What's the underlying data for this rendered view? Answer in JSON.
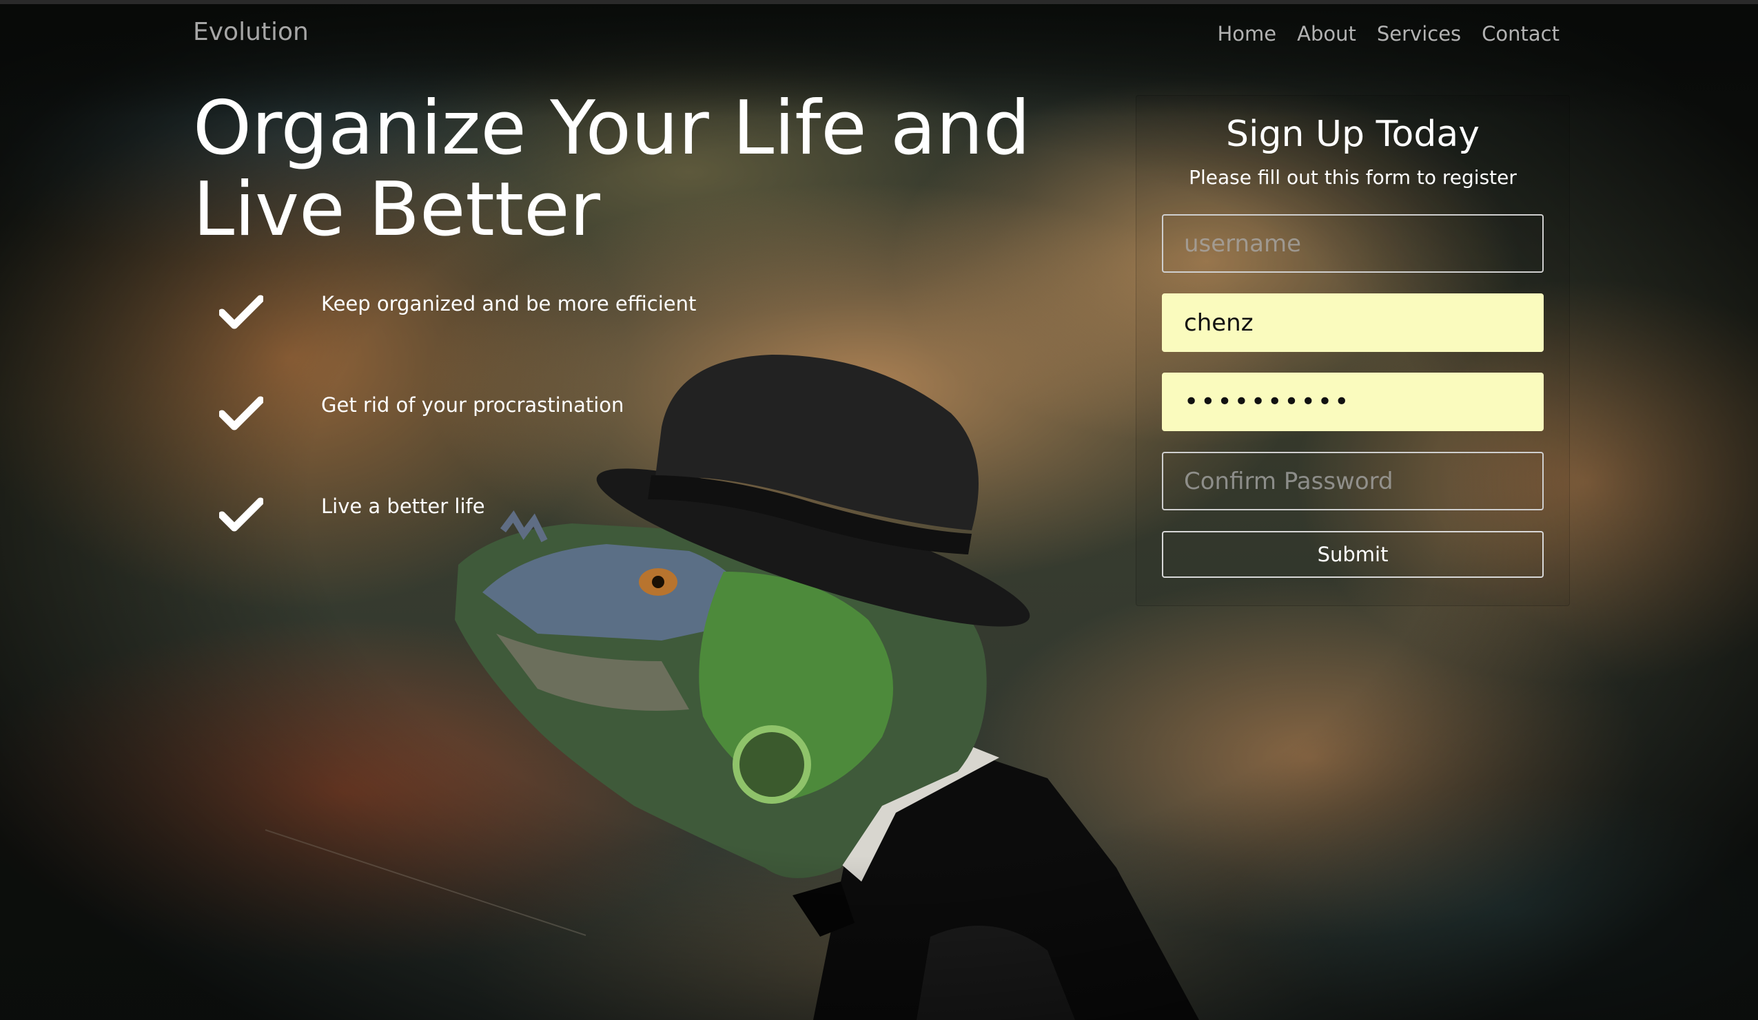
{
  "navbar": {
    "brand": "Evolution",
    "links": [
      "Home",
      "About",
      "Services",
      "Contact"
    ]
  },
  "hero": {
    "title": "Organize Your Life and Live Better",
    "features": [
      "Keep organized and be more efficient",
      "Get rid of your procrastination",
      "Live a better life"
    ]
  },
  "signup": {
    "title": "Sign Up Today",
    "subtitle": "Please fill out this form to register",
    "username_placeholder": "username",
    "email_value": "chenz",
    "password_value": "••••••••••",
    "confirm_placeholder": "Confirm Password",
    "submit_label": "Submit"
  },
  "icons": {
    "feature_icon": "checkmark-icon"
  },
  "colors": {
    "autofill_background": "#fafbbe",
    "heading_text": "#ffffff",
    "nav_text": "#b2b2b2"
  }
}
